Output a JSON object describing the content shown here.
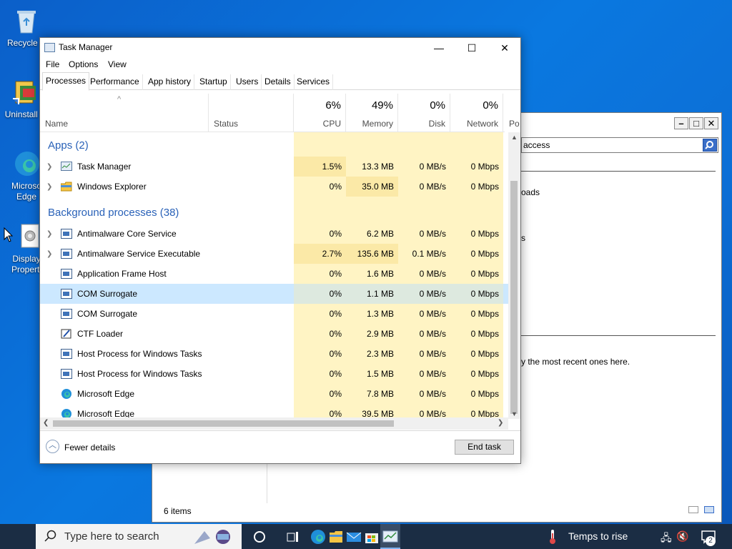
{
  "desktop": {
    "icons": [
      {
        "label": "Recycle B"
      },
      {
        "label": "Uninstall T"
      },
      {
        "label": "Microso Edge"
      },
      {
        "label": "Display Properti"
      }
    ]
  },
  "background_window": {
    "search_text": "access",
    "text_1": "oads",
    "text_2": "s",
    "text_3": "y the most recent ones here.",
    "status": "6 items"
  },
  "task_manager": {
    "title": "Task Manager",
    "menu": [
      "File",
      "Options",
      "View"
    ],
    "tabs": [
      "Processes",
      "Performance",
      "App history",
      "Startup",
      "Users",
      "Details",
      "Services"
    ],
    "columns": {
      "name": "Name",
      "status": "Status",
      "cpu": {
        "pct": "6%",
        "label": "CPU"
      },
      "memory": {
        "pct": "49%",
        "label": "Memory"
      },
      "disk": {
        "pct": "0%",
        "label": "Disk"
      },
      "network": {
        "pct": "0%",
        "label": "Network"
      },
      "power": "Po"
    },
    "groups": {
      "apps": "Apps (2)",
      "background": "Background processes (38)"
    },
    "apps": [
      {
        "name": "Task Manager",
        "cpu": "1.5%",
        "memory": "13.3 MB",
        "disk": "0 MB/s",
        "network": "0 Mbps"
      },
      {
        "name": "Windows Explorer",
        "cpu": "0%",
        "memory": "35.0 MB",
        "disk": "0 MB/s",
        "network": "0 Mbps"
      }
    ],
    "background": [
      {
        "name": "Antimalware Core Service",
        "cpu": "0%",
        "memory": "6.2 MB",
        "disk": "0 MB/s",
        "network": "0 Mbps"
      },
      {
        "name": "Antimalware Service Executable",
        "cpu": "2.7%",
        "memory": "135.6 MB",
        "disk": "0.1 MB/s",
        "network": "0 Mbps"
      },
      {
        "name": "Application Frame Host",
        "cpu": "0%",
        "memory": "1.6 MB",
        "disk": "0 MB/s",
        "network": "0 Mbps"
      },
      {
        "name": "COM Surrogate",
        "cpu": "0%",
        "memory": "1.1 MB",
        "disk": "0 MB/s",
        "network": "0 Mbps"
      },
      {
        "name": "COM Surrogate",
        "cpu": "0%",
        "memory": "1.3 MB",
        "disk": "0 MB/s",
        "network": "0 Mbps"
      },
      {
        "name": "CTF Loader",
        "cpu": "0%",
        "memory": "2.9 MB",
        "disk": "0 MB/s",
        "network": "0 Mbps"
      },
      {
        "name": "Host Process for Windows Tasks",
        "cpu": "0%",
        "memory": "2.3 MB",
        "disk": "0 MB/s",
        "network": "0 Mbps"
      },
      {
        "name": "Host Process for Windows Tasks",
        "cpu": "0%",
        "memory": "1.5 MB",
        "disk": "0 MB/s",
        "network": "0 Mbps"
      },
      {
        "name": "Microsoft Edge",
        "cpu": "0%",
        "memory": "7.8 MB",
        "disk": "0 MB/s",
        "network": "0 Mbps"
      },
      {
        "name": "Microsoft Edge",
        "cpu": "0%",
        "memory": "39.5 MB",
        "disk": "0 MB/s",
        "network": "0 Mbps"
      }
    ],
    "fewer_details": "Fewer details",
    "end_task": "End task"
  },
  "taskbar": {
    "search_placeholder": "Type here to search",
    "weather": "Temps to rise",
    "notification_count": "2"
  },
  "colors": {
    "accent": "#2a62b8",
    "heat_light": "#fff4c4",
    "heat_medium": "#fbe9a7",
    "selection": "#cce8ff",
    "taskbar": "#1b2d44"
  }
}
